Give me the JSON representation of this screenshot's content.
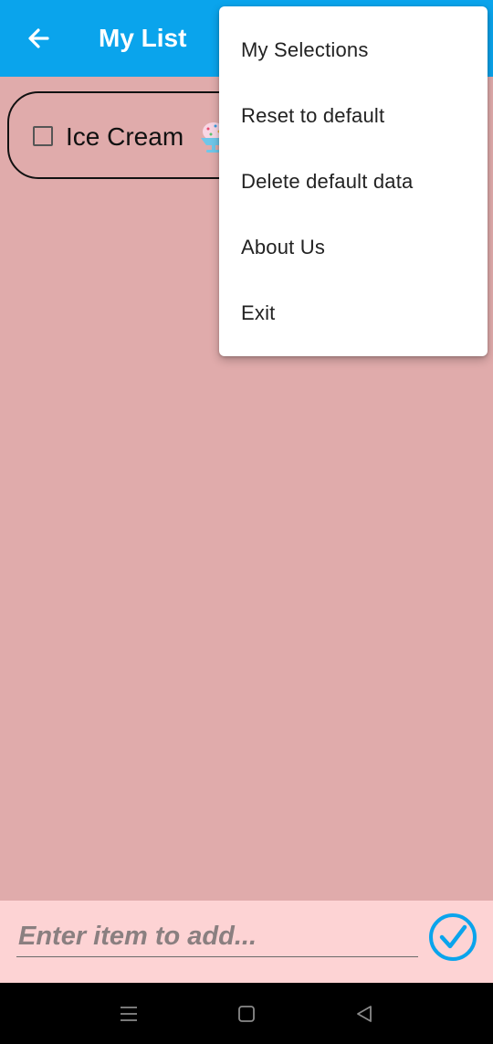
{
  "appbar": {
    "title": "My List",
    "background": "#0aa4ec"
  },
  "list": {
    "items": [
      {
        "label": "Ice Cream",
        "checked": false,
        "icon": "ice-cream-sundae-icon"
      }
    ]
  },
  "menu": {
    "items": [
      {
        "label": "My Selections"
      },
      {
        "label": "Reset to default"
      },
      {
        "label": "Delete default data"
      },
      {
        "label": "About Us"
      },
      {
        "label": "Exit"
      }
    ]
  },
  "add_bar": {
    "placeholder": "Enter item to add...",
    "confirm_icon": "check-circle-icon",
    "accent": "#0aa4ec"
  },
  "navbar": {
    "icons": [
      "menu-icon",
      "home-square-icon",
      "back-triangle-icon"
    ]
  }
}
